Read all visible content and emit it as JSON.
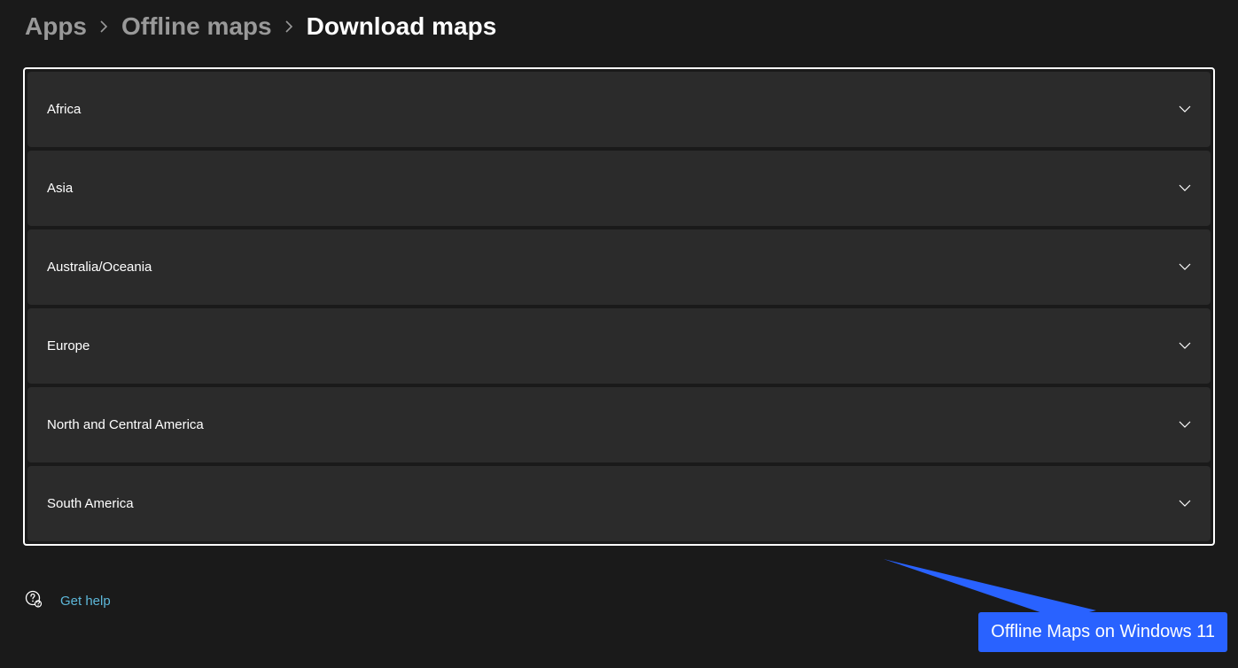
{
  "breadcrumb": {
    "item1": "Apps",
    "item2": "Offline maps",
    "current": "Download maps"
  },
  "regions": [
    {
      "label": "Africa"
    },
    {
      "label": "Asia"
    },
    {
      "label": "Australia/Oceania"
    },
    {
      "label": "Europe"
    },
    {
      "label": "North and Central America"
    },
    {
      "label": "South America"
    }
  ],
  "help": {
    "label": "Get help"
  },
  "callout": {
    "text": "Offline Maps on Windows 11"
  }
}
